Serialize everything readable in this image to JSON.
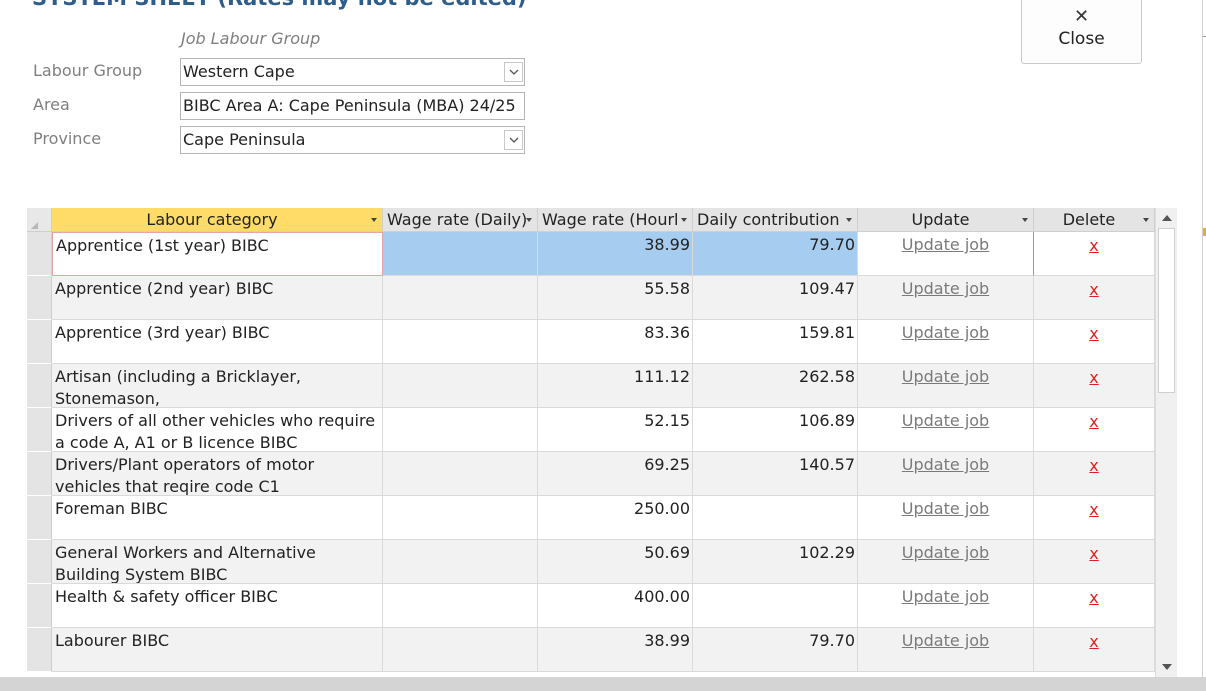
{
  "window": {
    "title": "SYSTEM SHEET (Rates may not be edited)"
  },
  "close_button": {
    "label": "Close",
    "icon": "close-icon"
  },
  "form": {
    "group_header": "Job Labour Group",
    "labour_group": {
      "label": "Labour Group",
      "value": "Western Cape"
    },
    "area": {
      "label": "Area",
      "value": "BIBC Area A: Cape Peninsula (MBA) 24/25"
    },
    "province": {
      "label": "Province",
      "value": "Cape Peninsula"
    }
  },
  "table": {
    "columns": [
      {
        "label": "Labour category"
      },
      {
        "label": "Wage rate (Daily)"
      },
      {
        "label": "Wage rate (Hourl"
      },
      {
        "label": "Daily contribution"
      },
      {
        "label": "Update"
      },
      {
        "label": "Delete"
      }
    ],
    "rows": [
      {
        "category": "Apprentice (1st year) BIBC",
        "daily": "",
        "hourly": "38.99",
        "contribution": "79.70",
        "update": "Update job",
        "delete": "x"
      },
      {
        "category": "Apprentice (2nd year) BIBC",
        "daily": "",
        "hourly": "55.58",
        "contribution": "109.47",
        "update": "Update job",
        "delete": "x"
      },
      {
        "category": "Apprentice (3rd year) BIBC",
        "daily": "",
        "hourly": "83.36",
        "contribution": "159.81",
        "update": "Update job",
        "delete": "x"
      },
      {
        "category": "Artisan (including a Bricklayer, Stonemason,",
        "daily": "",
        "hourly": "111.12",
        "contribution": "262.58",
        "update": "Update job",
        "delete": "x"
      },
      {
        "category": "Drivers of all other vehicles who require a code A, A1 or B licence BIBC",
        "daily": "",
        "hourly": "52.15",
        "contribution": "106.89",
        "update": "Update job",
        "delete": "x"
      },
      {
        "category": "Drivers/Plant operators of motor vehicles that reqire code C1",
        "daily": "",
        "hourly": "69.25",
        "contribution": "140.57",
        "update": "Update job",
        "delete": "x"
      },
      {
        "category": "Foreman BIBC",
        "daily": "",
        "hourly": "250.00",
        "contribution": "",
        "update": "Update job",
        "delete": "x"
      },
      {
        "category": "General Workers and Alternative Building System BIBC",
        "daily": "",
        "hourly": "50.69",
        "contribution": "102.29",
        "update": "Update job",
        "delete": "x"
      },
      {
        "category": "Health & safety officer BIBC",
        "daily": "",
        "hourly": "400.00",
        "contribution": "",
        "update": "Update job",
        "delete": "x"
      },
      {
        "category": "Labourer BIBC",
        "daily": "",
        "hourly": "38.99",
        "contribution": "79.70",
        "update": "Update job",
        "delete": "x"
      }
    ]
  }
}
